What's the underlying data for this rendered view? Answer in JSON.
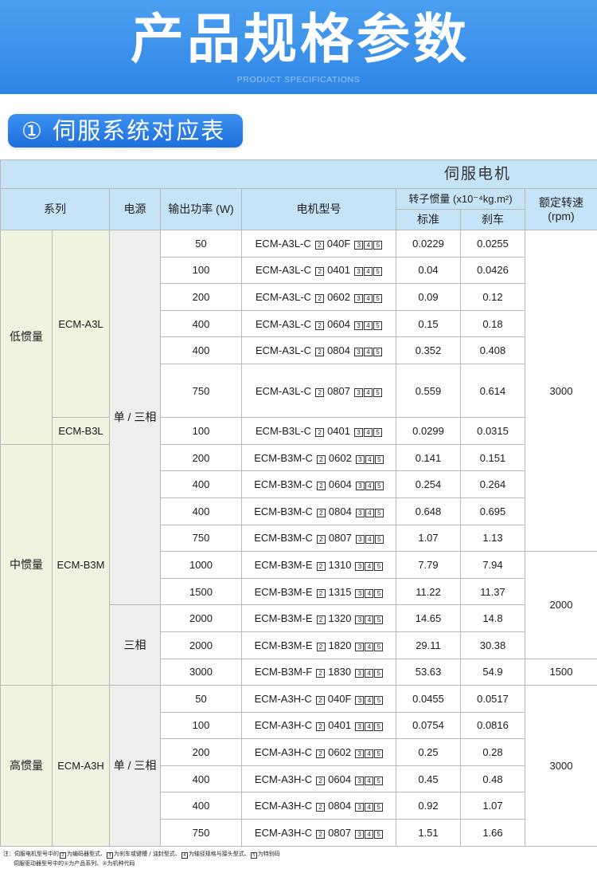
{
  "banner": {
    "title": "产品规格参数",
    "subtitle": "PRODUCT SPECIFICATIONS"
  },
  "section": {
    "title": "① 伺服系统对应表"
  },
  "table": {
    "group_header": "伺服电机",
    "headers": {
      "series": "系列",
      "supply": "电源",
      "power": "输出功率 (W)",
      "model": "电机型号",
      "inertia": "转子惯量 (x10⁻⁴kg.m²)",
      "standard": "标准",
      "brake": "刹车",
      "speed_line1": "额定转速",
      "speed_line2": "(rpm)"
    },
    "model_slots": {
      "after_prefix": "2",
      "after_code": [
        "3",
        "4",
        "5"
      ]
    },
    "rows": [
      {
        "inertia_class": "低惯量",
        "series": "ECM-A3L",
        "supply": "单 / 三相",
        "power": "50",
        "model_prefix": "ECM-A3L-C",
        "model_code": "040F",
        "standard": "0.0229",
        "brake": "0.0255",
        "speed": "3000"
      },
      {
        "power": "100",
        "model_prefix": "ECM-A3L-C",
        "model_code": "0401",
        "standard": "0.04",
        "brake": "0.0426"
      },
      {
        "power": "200",
        "model_prefix": "ECM-A3L-C",
        "model_code": "0602",
        "standard": "0.09",
        "brake": "0.12"
      },
      {
        "power": "400",
        "model_prefix": "ECM-A3L-C",
        "model_code": "0604",
        "standard": "0.15",
        "brake": "0.18"
      },
      {
        "power": "400",
        "model_prefix": "ECM-A3L-C",
        "model_code": "0804",
        "standard": "0.352",
        "brake": "0.408"
      },
      {
        "power": "750",
        "model_prefix": "ECM-A3L-C",
        "model_code": "0807",
        "standard": "0.559",
        "brake": "0.614"
      },
      {
        "series": "ECM-B3L",
        "power": "100",
        "model_prefix": "ECM-B3L-C",
        "model_code": "0401",
        "standard": "0.0299",
        "brake": "0.0315"
      },
      {
        "inertia_class": "中惯量",
        "series": "ECM-B3M",
        "power": "200",
        "model_prefix": "ECM-B3M-C",
        "model_code": "0602",
        "standard": "0.141",
        "brake": "0.151"
      },
      {
        "power": "400",
        "model_prefix": "ECM-B3M-C",
        "model_code": "0604",
        "standard": "0.254",
        "brake": "0.264"
      },
      {
        "power": "400",
        "model_prefix": "ECM-B3M-C",
        "model_code": "0804",
        "standard": "0.648",
        "brake": "0.695"
      },
      {
        "power": "750",
        "model_prefix": "ECM-B3M-C",
        "model_code": "0807",
        "standard": "1.07",
        "brake": "1.13"
      },
      {
        "power": "1000",
        "model_prefix": "ECM-B3M-E",
        "model_code": "1310",
        "standard": "7.79",
        "brake": "7.94",
        "speed": "2000"
      },
      {
        "power": "1500",
        "model_prefix": "ECM-B3M-E",
        "model_code": "1315",
        "standard": "11.22",
        "brake": "11.37"
      },
      {
        "supply": "三相",
        "power": "2000",
        "model_prefix": "ECM-B3M-E",
        "model_code": "1320",
        "standard": "14.65",
        "brake": "14.8"
      },
      {
        "power": "2000",
        "model_prefix": "ECM-B3M-E",
        "model_code": "1820",
        "standard": "29.11",
        "brake": "30.38"
      },
      {
        "power": "3000",
        "model_prefix": "ECM-B3M-F",
        "model_code": "1830",
        "standard": "53.63",
        "brake": "54.9",
        "speed": "1500"
      },
      {
        "inertia_class": "高惯量",
        "series": "ECM-A3H",
        "supply": "单 / 三相",
        "power": "50",
        "model_prefix": "ECM-A3H-C",
        "model_code": "040F",
        "standard": "0.0455",
        "brake": "0.0517",
        "speed": "3000"
      },
      {
        "power": "100",
        "model_prefix": "ECM-A3H-C",
        "model_code": "0401",
        "standard": "0.0754",
        "brake": "0.0816"
      },
      {
        "power": "200",
        "model_prefix": "ECM-A3H-C",
        "model_code": "0602",
        "standard": "0.25",
        "brake": "0.28"
      },
      {
        "power": "400",
        "model_prefix": "ECM-A3H-C",
        "model_code": "0604",
        "standard": "0.45",
        "brake": "0.48"
      },
      {
        "power": "400",
        "model_prefix": "ECM-A3H-C",
        "model_code": "0804",
        "standard": "0.92",
        "brake": "1.07"
      },
      {
        "power": "750",
        "model_prefix": "ECM-A3H-C",
        "model_code": "0807",
        "standard": "1.51",
        "brake": "1.66"
      }
    ]
  },
  "notes": {
    "line1": {
      "prefix": "注：伺服电机型号中的",
      "items": [
        {
          "num": "2",
          "text": "为编码器型式、"
        },
        {
          "num": "3",
          "text": "为刹车或键槽 / 油封型式、"
        },
        {
          "num": "4",
          "text": "为轴径规格与接头型式、"
        },
        {
          "num": "5",
          "text": "为特别码"
        }
      ]
    },
    "line2": "伺服驱动器型号中的①为产品系列、②为机种代码"
  },
  "colors": {
    "banner_top": "#4b9ff0",
    "banner_bottom": "#2f86e6",
    "pill_top": "#3d91f1",
    "pill_bottom": "#1e6fdb",
    "header_bg": "#c6e4f7",
    "series_bg": "#eef4e0",
    "supply_bg": "#efefef",
    "grid_line": "#b8b8b8"
  }
}
